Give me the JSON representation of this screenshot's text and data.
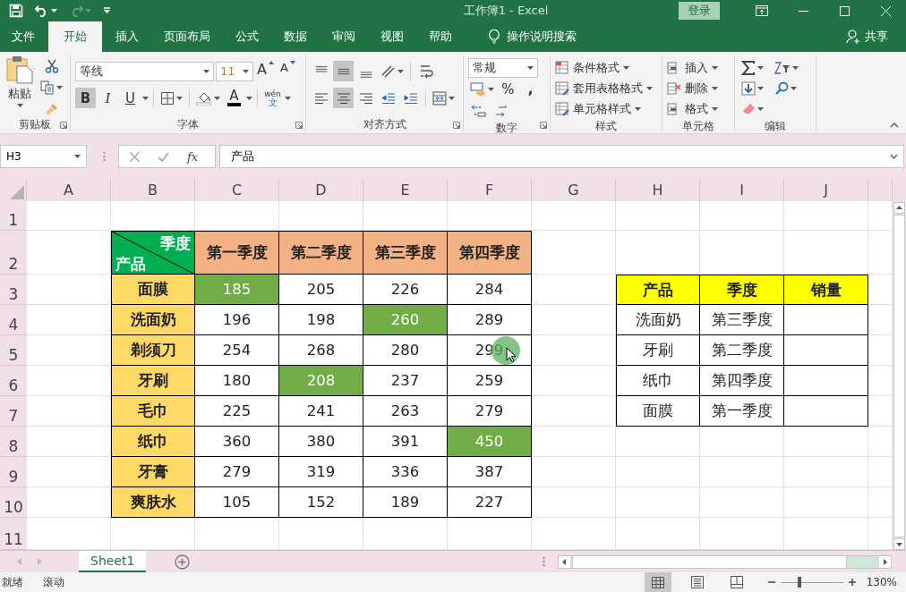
{
  "title_bar": {
    "quick_access": [
      {
        "kind": "save",
        "disabled": false
      },
      {
        "kind": "undo",
        "disabled": false
      },
      {
        "kind": "redo",
        "disabled": true
      },
      {
        "kind": "customize",
        "disabled": false
      }
    ],
    "title": "工作簿1  -  Excel",
    "login": "登录"
  },
  "menu_tabs": [
    {
      "label": "文件",
      "selected": false
    },
    {
      "label": "开始",
      "selected": true
    },
    {
      "label": "插入",
      "selected": false
    },
    {
      "label": "页面布局",
      "selected": false
    },
    {
      "label": "公式",
      "selected": false
    },
    {
      "label": "数据",
      "selected": false
    },
    {
      "label": "审阅",
      "selected": false
    },
    {
      "label": "视图",
      "selected": false
    },
    {
      "label": "帮助",
      "selected": false
    }
  ],
  "search": {
    "placeholder": "操作说明搜索"
  },
  "share": "共享",
  "ribbon": {
    "groups": [
      {
        "kind": "clipboard",
        "label": "剪贴板",
        "launcher": true,
        "paste": "粘贴"
      },
      {
        "kind": "font",
        "label": "字体",
        "launcher": true,
        "font": "等线",
        "size": "11",
        "grow": "A",
        "shrink": "A",
        "styles": [
          {
            "label": "B",
            "pressed": true
          },
          {
            "label": "I",
            "pressed": false
          },
          {
            "label": "U",
            "pressed": false
          }
        ],
        "font_color": "A",
        "phonetic": "wén",
        "phonetic_char": "文"
      },
      {
        "kind": "alignment",
        "label": "对齐方式",
        "launcher": true,
        "vertical": [
          {
            "pressed": false
          },
          {
            "pressed": true
          },
          {
            "pressed": false
          }
        ],
        "horizontal": [
          {
            "pressed": false
          },
          {
            "pressed": true
          },
          {
            "pressed": false
          }
        ]
      },
      {
        "kind": "number",
        "label": "数字",
        "launcher": true,
        "format": "常规",
        "percent": "%",
        "comma": ","
      },
      {
        "kind": "styles",
        "label": "样式",
        "items": [
          "条件格式",
          "套用表格格式",
          "单元格样式"
        ]
      },
      {
        "kind": "cells",
        "label": "单元格",
        "items": [
          "插入",
          "删除",
          "格式"
        ]
      },
      {
        "kind": "editing",
        "label": "编辑"
      }
    ]
  },
  "formula_bar": {
    "name_box": "H3",
    "function_label": "fx",
    "value": "产品"
  },
  "sheet": {
    "columns": [
      "A",
      "B",
      "C",
      "D",
      "E",
      "F",
      "G",
      "H",
      "I",
      "J"
    ],
    "rows": [
      "1",
      "2",
      "3",
      "4",
      "5",
      "6",
      "7",
      "8",
      "9",
      "10",
      "11"
    ]
  },
  "main_table": {
    "corner": {
      "top": "季度",
      "bottom": "产品"
    },
    "headers": [
      "第一季度",
      "第二季度",
      "第三季度",
      "第四季度"
    ],
    "rows": [
      {
        "product": "面膜",
        "values": [
          {
            "text": "185",
            "highlighted": true
          },
          {
            "text": "205",
            "highlighted": false
          },
          {
            "text": "226",
            "highlighted": false
          },
          {
            "text": "284",
            "highlighted": false
          }
        ]
      },
      {
        "product": "洗面奶",
        "values": [
          {
            "text": "196",
            "highlighted": false
          },
          {
            "text": "198",
            "highlighted": false
          },
          {
            "text": "260",
            "highlighted": true
          },
          {
            "text": "289",
            "highlighted": false
          }
        ]
      },
      {
        "product": "剃须刀",
        "values": [
          {
            "text": "254",
            "highlighted": false
          },
          {
            "text": "268",
            "highlighted": false
          },
          {
            "text": "280",
            "highlighted": false
          },
          {
            "text": "299",
            "highlighted": false
          }
        ]
      },
      {
        "product": "牙刷",
        "values": [
          {
            "text": "180",
            "highlighted": false
          },
          {
            "text": "208",
            "highlighted": true
          },
          {
            "text": "237",
            "highlighted": false
          },
          {
            "text": "259",
            "highlighted": false
          }
        ]
      },
      {
        "product": "毛巾",
        "values": [
          {
            "text": "225",
            "highlighted": false
          },
          {
            "text": "241",
            "highlighted": false
          },
          {
            "text": "263",
            "highlighted": false
          },
          {
            "text": "279",
            "highlighted": false
          }
        ]
      },
      {
        "product": "纸巾",
        "values": [
          {
            "text": "360",
            "highlighted": false
          },
          {
            "text": "380",
            "highlighted": false
          },
          {
            "text": "391",
            "highlighted": false
          },
          {
            "text": "450",
            "highlighted": true
          }
        ]
      },
      {
        "product": "牙膏",
        "values": [
          {
            "text": "279",
            "highlighted": false
          },
          {
            "text": "319",
            "highlighted": false
          },
          {
            "text": "336",
            "highlighted": false
          },
          {
            "text": "387",
            "highlighted": false
          }
        ]
      },
      {
        "product": "爽肤水",
        "values": [
          {
            "text": "105",
            "highlighted": false
          },
          {
            "text": "152",
            "highlighted": false
          },
          {
            "text": "189",
            "highlighted": false
          },
          {
            "text": "227",
            "highlighted": false
          }
        ]
      }
    ]
  },
  "lookup_table": {
    "headers": [
      "产品",
      "季度",
      "销量"
    ],
    "rows": [
      {
        "product": "洗面奶",
        "quarter": "第三季度"
      },
      {
        "product": "牙刷",
        "quarter": "第二季度"
      },
      {
        "product": "纸巾",
        "quarter": "第四季度"
      },
      {
        "product": "面膜",
        "quarter": "第一季度"
      }
    ]
  },
  "sheet_tabs": [
    {
      "label": "Sheet1",
      "selected": true
    }
  ],
  "status_bar": {
    "items": [
      "就绪",
      "滚动"
    ],
    "views": [
      {
        "kind": "normal",
        "selected": true
      },
      {
        "kind": "page_layout",
        "selected": false
      },
      {
        "kind": "page_break",
        "selected": false
      }
    ],
    "zoom": {
      "level": 0.3,
      "reading": "130%"
    }
  }
}
